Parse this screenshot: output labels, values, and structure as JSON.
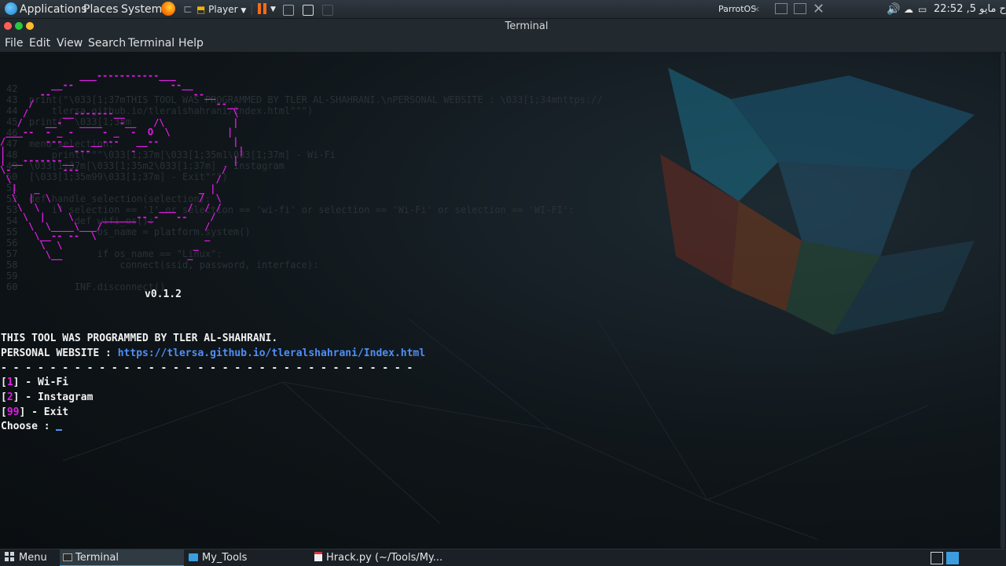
{
  "top_panel": {
    "applications": "Applications",
    "places": "Places",
    "system": "System",
    "player": "Player",
    "parrotos": "ParrotOS",
    "clock": "ح مايو 5, 22:52"
  },
  "window": {
    "title": "Terminal"
  },
  "menu": [
    "File",
    "Edit",
    "View",
    "Search",
    "Terminal",
    "Help"
  ],
  "terminal": {
    "banner_art": "              ___-----------___\n         __--                 --__\n       --                         --__\n     /                                --__\n    /      __-------__                   \\\n   /    __-   ____   -__   /\\            |\n ___--  - _ -     - _  -  O  \\          |\n/       ---__   __---   __--             |\n|            ---       -                  |\n| __-------__                            |\n\\-         ---                         /\n \\                                    /\n  |   _                            _ |\n  \\  |  \\                          /  \\\n   \\  \\   \\                 ___  /  / /\n    \\  |    \\     ______--_-   --    /\n     \\  \\____\\___/                  /\n      \\__-- --  \\                   _\n       \\  \\                       _\n        \\__                      _",
    "version": "v0.1.2",
    "programmed_by": "THIS TOOL WAS PROGRAMMED BY TLER AL-SHAHRANI.",
    "website_label": "PERSONAL WEBSITE : ",
    "website_url": "https://tlersa.github.io/tleralshahrani/Index.html",
    "separator": "- - - - - - - - - - - - - - - - - - - - - - - - - - - - - - - - - -",
    "options": [
      {
        "key": "1",
        "label": " - Wi-Fi"
      },
      {
        "key": "2",
        "label": " - Instagram"
      },
      {
        "key": "99",
        "label": " - Exit"
      }
    ],
    "prompt": "Choose : "
  },
  "taskbar": {
    "menu": "Menu",
    "tasks": [
      "Terminal",
      "My_Tools",
      "Hrack.py (~/Tools/My..."
    ]
  },
  "colors": {
    "magenta": "#e21ce6",
    "link": "#4f8ff6",
    "accent": "#3b9ddd"
  }
}
